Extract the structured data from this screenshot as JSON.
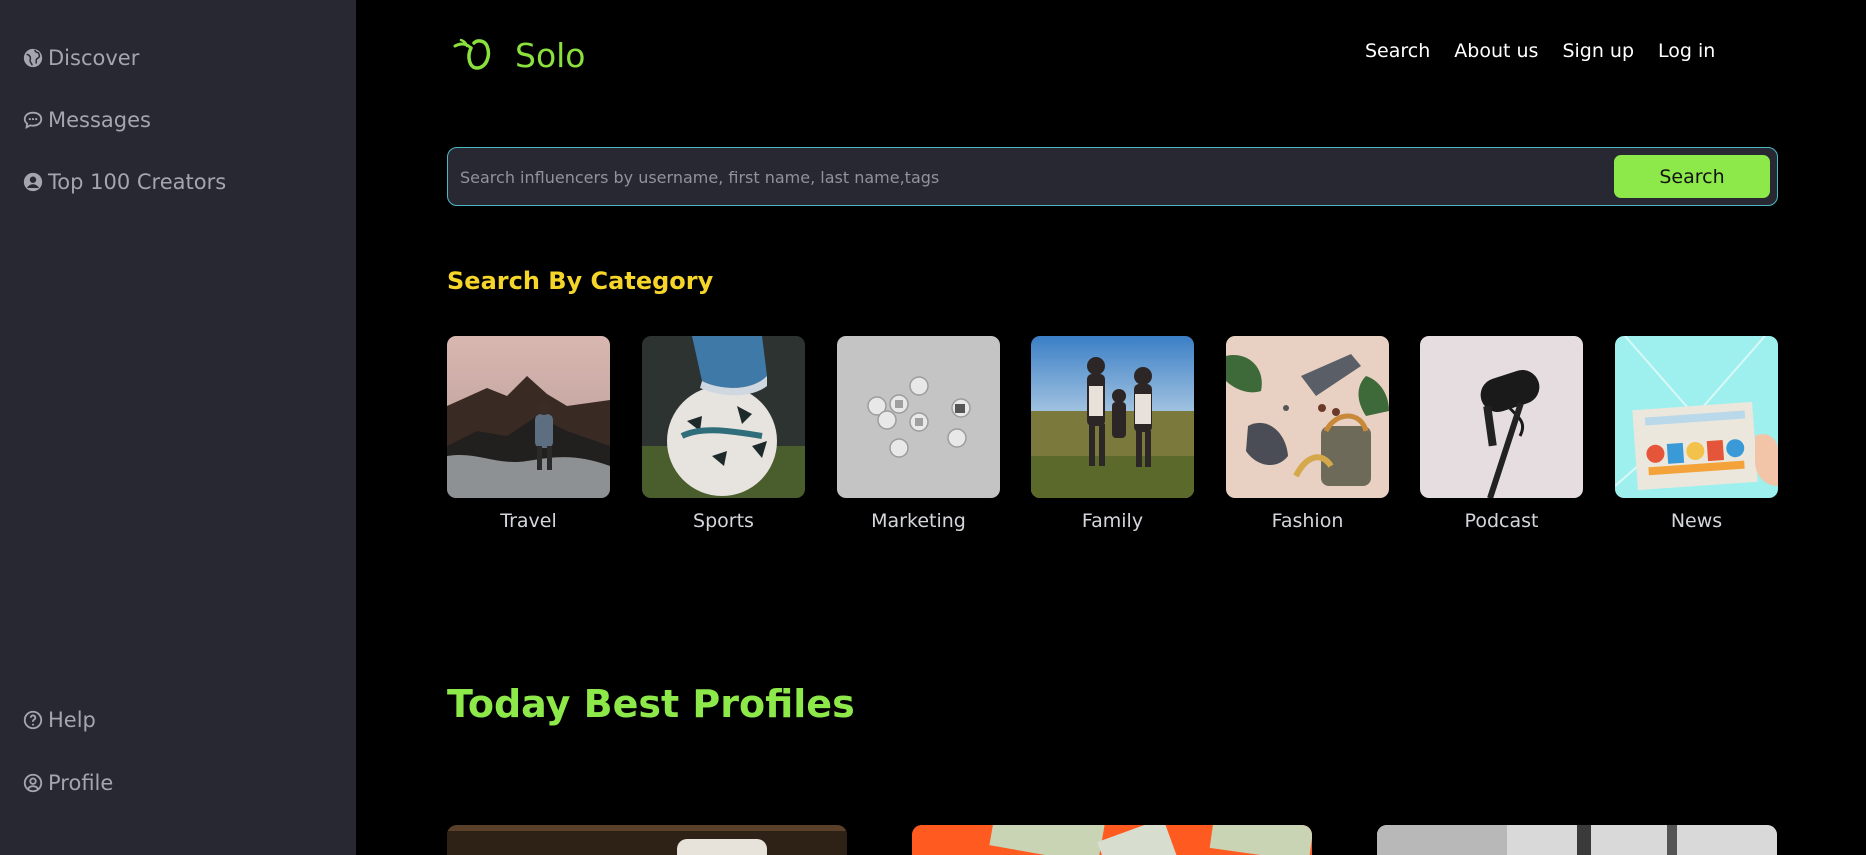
{
  "sidebar": {
    "top_items": [
      {
        "label": "Discover",
        "icon": "globe-icon"
      },
      {
        "label": "Messages",
        "icon": "chat-icon"
      },
      {
        "label": "Top 100 Creators",
        "icon": "user-circle-icon"
      }
    ],
    "bottom_items": [
      {
        "label": "Help",
        "icon": "help-circle-icon"
      },
      {
        "label": "Profile",
        "icon": "profile-icon"
      }
    ]
  },
  "header": {
    "logo_text": "Solo",
    "nav": [
      "Search",
      "About us",
      "Sign up",
      "Log in"
    ]
  },
  "search": {
    "placeholder": "Search influencers by username, first name, last name,tags",
    "value": "",
    "button_label": "Search"
  },
  "categories_section": {
    "heading": "Search By Category",
    "items": [
      {
        "label": "Travel"
      },
      {
        "label": "Sports"
      },
      {
        "label": "Marketing"
      },
      {
        "label": "Family"
      },
      {
        "label": "Fashion"
      },
      {
        "label": "Podcast"
      },
      {
        "label": "News"
      }
    ]
  },
  "best_profiles": {
    "heading": "Today Best Profiles"
  },
  "colors": {
    "accent_green": "#8de84a",
    "heading_yellow": "#f6d52a",
    "sidebar_bg": "#272831",
    "page_bg": "#000000",
    "search_border": "#4cb8c4"
  }
}
